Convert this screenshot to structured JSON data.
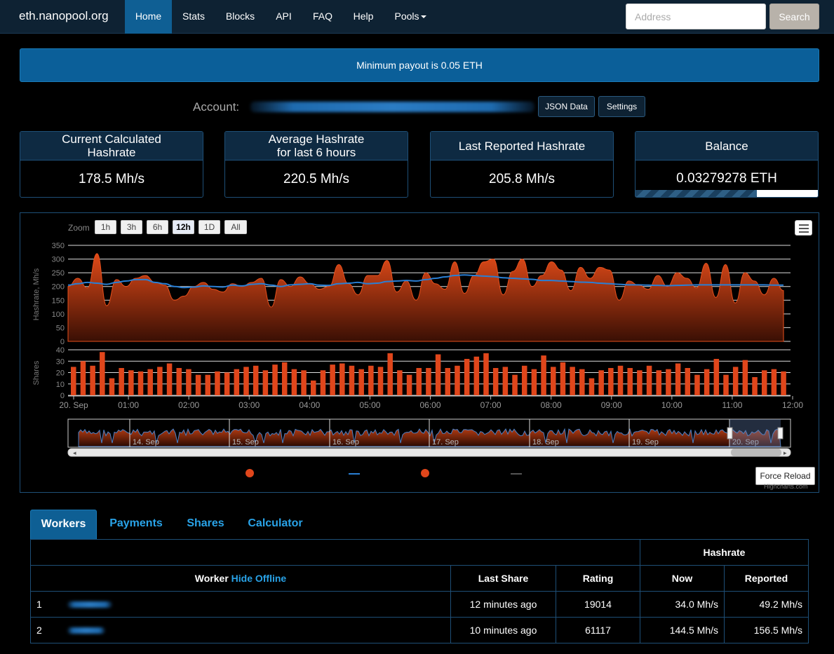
{
  "navbar": {
    "brand": "eth.nanopool.org",
    "items": [
      "Home",
      "Stats",
      "Blocks",
      "API",
      "FAQ",
      "Help",
      "Pools"
    ],
    "active": "Home",
    "search_placeholder": "Address",
    "search_label": "Search"
  },
  "alert": "Minimum payout is 0.05 ETH",
  "account": {
    "label": "Account:",
    "json_button": "JSON Data",
    "settings_button": "Settings"
  },
  "stats": [
    {
      "title": "Current Calculated Hashrate",
      "value": "178.5 Mh/s"
    },
    {
      "title": "Average Hashrate for last 6 hours",
      "value": "220.5 Mh/s"
    },
    {
      "title": "Last Reported Hashrate",
      "value": "205.8 Mh/s"
    },
    {
      "title": "Balance",
      "value": "0.03279278 ETH",
      "progress": 0.66
    }
  ],
  "chart": {
    "zoom_label": "Zoom",
    "zoom_buttons": [
      "1h",
      "3h",
      "6h",
      "12h",
      "1D",
      "All"
    ],
    "zoom_active": "12h",
    "tooltip": "Force Reload",
    "credit": "Highcharts.com",
    "colors": {
      "hashrate": "#d9451a",
      "average": "#2a7fd4",
      "shares": "#e0461b"
    }
  },
  "chart_data": [
    {
      "type": "area",
      "ylabel": "Hashrate, Mh/s",
      "ylim": [
        0,
        350
      ],
      "yticks": [
        0,
        50,
        100,
        150,
        200,
        250,
        300,
        350
      ],
      "xticks": [
        "20. Sep",
        "01:00",
        "02:00",
        "03:00",
        "04:00",
        "05:00",
        "06:00",
        "07:00",
        "08:00",
        "09:00",
        "10:00",
        "11:00",
        "12:00"
      ],
      "grid": true,
      "series": [
        {
          "values": [
            200,
            230,
            195,
            320,
            130,
            225,
            200,
            230,
            240,
            215,
            205,
            150,
            165,
            200,
            215,
            190,
            180,
            210,
            200,
            215,
            230,
            125,
            225,
            200,
            235,
            210,
            190,
            200,
            280,
            210,
            170,
            240,
            240,
            295,
            180,
            220,
            150,
            250,
            210,
            190,
            290,
            175,
            240,
            290,
            300,
            170,
            255,
            300,
            200,
            240,
            290,
            260,
            185,
            270,
            230,
            270,
            260,
            150,
            220,
            205,
            190,
            240,
            200,
            250,
            230,
            195,
            285,
            160,
            280,
            140,
            250,
            220,
            170,
            230,
            185
          ]
        },
        {
          "values": [
            205,
            210,
            215,
            212,
            208,
            215,
            220,
            225,
            225,
            215,
            210,
            200,
            196,
            198,
            202,
            200,
            198,
            205,
            202,
            208,
            210,
            205,
            200,
            206,
            208,
            210,
            205,
            204,
            210,
            212,
            215,
            210,
            212,
            218,
            220,
            222,
            220,
            225,
            230,
            235,
            240,
            242,
            240,
            238,
            236,
            232,
            230,
            228,
            226,
            222,
            222,
            220,
            218,
            216,
            215,
            212,
            210,
            208,
            206,
            206,
            205,
            204,
            203,
            204,
            205,
            206,
            206,
            206,
            206,
            206,
            206,
            206,
            206,
            205,
            205
          ]
        }
      ]
    },
    {
      "type": "bar",
      "ylabel": "Shares",
      "ylim": [
        0,
        40
      ],
      "yticks": [
        0,
        10,
        20,
        30,
        40
      ],
      "values": [
        25,
        30,
        26,
        38,
        15,
        24,
        22,
        21,
        23,
        25,
        28,
        24,
        23,
        18,
        18,
        21,
        20,
        23,
        25,
        26,
        22,
        27,
        29,
        23,
        22,
        13,
        22,
        27,
        28,
        26,
        23,
        26,
        25,
        37,
        22,
        18,
        24,
        24,
        36,
        24,
        26,
        32,
        34,
        37,
        24,
        25,
        18,
        26,
        23,
        35,
        25,
        29,
        25,
        23,
        15,
        22,
        24,
        26,
        24,
        22,
        26,
        22,
        23,
        28,
        24,
        18,
        23,
        32,
        18,
        25,
        31,
        16,
        22,
        23,
        21
      ]
    }
  ],
  "navigator": {
    "labels": [
      "14. Sep",
      "15. Sep",
      "16. Sep",
      "17. Sep",
      "18. Sep",
      "19. Sep",
      "20. Sep"
    ]
  },
  "tabs": {
    "items": [
      "Workers",
      "Payments",
      "Shares",
      "Calculator"
    ],
    "active": "Workers"
  },
  "workers_table": {
    "group_header": "Hashrate",
    "worker_header": "Worker",
    "hide_offline": "Hide Offline",
    "columns": [
      "Last Share",
      "Rating",
      "Now",
      "Reported"
    ],
    "rows": [
      {
        "num": "1",
        "last_share": "12 minutes ago",
        "rating": "19014",
        "now": "34.0 Mh/s",
        "reported": "49.2 Mh/s"
      },
      {
        "num": "2",
        "last_share": "10 minutes ago",
        "rating": "61117",
        "now": "144.5 Mh/s",
        "reported": "156.5 Mh/s"
      }
    ]
  }
}
